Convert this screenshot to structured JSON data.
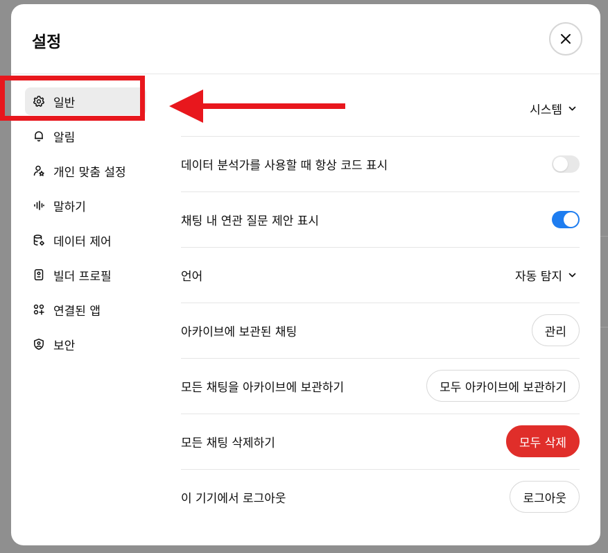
{
  "header": {
    "title": "설정"
  },
  "sidebar": {
    "items": [
      {
        "label": "일반",
        "icon": "gear-icon",
        "active": true
      },
      {
        "label": "알림",
        "icon": "bell-icon"
      },
      {
        "label": "개인 맞춤 설정",
        "icon": "personalization-icon"
      },
      {
        "label": "말하기",
        "icon": "waveform-icon"
      },
      {
        "label": "데이터 제어",
        "icon": "database-gear-icon"
      },
      {
        "label": "빌더 프로필",
        "icon": "id-badge-icon"
      },
      {
        "label": "연결된 앱",
        "icon": "apps-grid-icon"
      },
      {
        "label": "보안",
        "icon": "shield-icon"
      }
    ]
  },
  "general": {
    "theme": {
      "value": "시스템"
    },
    "show_code": {
      "label": "데이터 분석가를 사용할 때 항상 코드 표시",
      "enabled": false
    },
    "follow_up": {
      "label": "채팅 내 연관 질문 제안 표시",
      "enabled": true
    },
    "language": {
      "label": "언어",
      "value": "자동 탐지"
    },
    "archived": {
      "label": "아카이브에 보관된 채팅",
      "button": "관리"
    },
    "archive_all": {
      "label": "모든 채팅을 아카이브에 보관하기",
      "button": "모두 아카이브에 보관하기"
    },
    "delete_all": {
      "label": "모든 채팅 삭제하기",
      "button": "모두 삭제"
    },
    "logout": {
      "label": "이 기기에서 로그아웃",
      "button": "로그아웃"
    }
  },
  "colors": {
    "toggle_on": "#1e7df0",
    "danger": "#e02e2a",
    "annotation": "#e8171d"
  }
}
